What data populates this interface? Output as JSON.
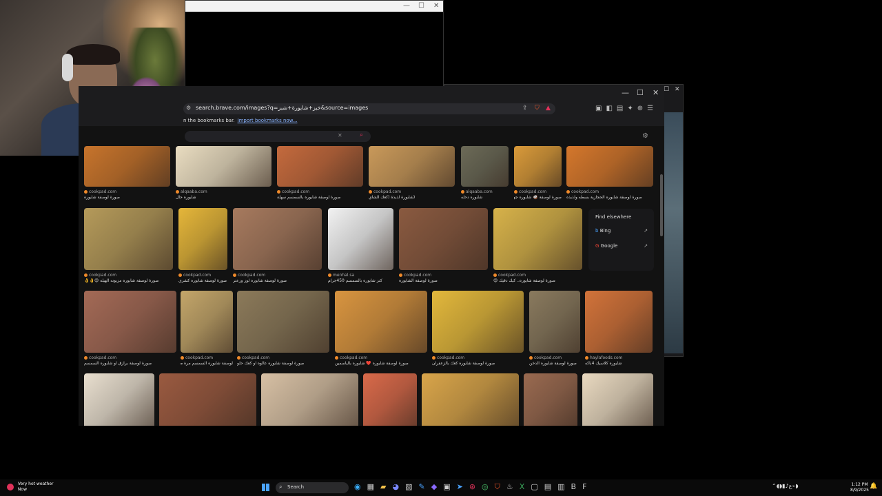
{
  "browser": {
    "url": "search.brave.com/images?q=خبز+شايورة+شبز&source=images",
    "bookmarks_prefix": "n the bookmarks bar.",
    "bookmarks_link": "Import bookmarks now..."
  },
  "find_elsewhere": {
    "heading": "Find elsewhere",
    "engines": [
      "Bing",
      "Google"
    ]
  },
  "rows": [
    [
      {
        "src": "cookpad.com",
        "cap": "صورة لوصفة شايوره",
        "color": "#c7742c"
      },
      {
        "src": "alqaaba.com",
        "cap": "شايوره حال",
        "color": "#e9dcc0"
      },
      {
        "src": "cookpad.com",
        "cap": "صورة لوصفة شايوره بالسمسم سهلة",
        "color": "#c46a3d"
      },
      {
        "src": "cookpad.com",
        "cap": "(شايورة لذيذة (كعك الشاي",
        "color": "#c9995a"
      },
      {
        "src": "alqaaba.com",
        "cap": "شايوره دحله",
        "color": "#6c6a57"
      },
      {
        "src": "cookpad.com",
        "cap": "صورة لوصفة 🥥 شايوره جوز الهند",
        "color": "#d99a3a"
      },
      {
        "src": "cookpad.com",
        "cap": "صورة لوصفة شايوره الحجازية بسطه ولذيذه",
        "color": "#d4772c"
      }
    ],
    [
      {
        "src": "cookpad.com",
        "cap": "صورة لوصفة شايوره مزيونه الهيله 😍👌👌",
        "color": "#b59a5a"
      },
      {
        "src": "cookpad.com",
        "cap": "صورة لوصفة شايوره كشري",
        "color": "#e5b63a"
      },
      {
        "src": "cookpad.com",
        "cap": "صورة لوصفة شايوره لوز وزعتر",
        "color": "#a77a5e"
      },
      {
        "src": "menhal.sa",
        "cap": "كنز شايوره بالسمسم 450جرام",
        "color": "#f2f2f2"
      },
      {
        "src": "cookpad.com",
        "cap": "صورة لوصفة الشايوره",
        "color": "#8a5a40"
      },
      {
        "src": "cookpad.com",
        "cap": "صورة لوصفة شايوره.. كيك دقيك 😍",
        "color": "#d7b24a"
      }
    ],
    [
      {
        "src": "cookpad.com",
        "cap": "صورة لوصفة برازق او شايوره السمسم",
        "color": "#a46a56"
      },
      {
        "src": "cookpad.com",
        "cap": "لوصفة شايوره السمسم مرة طرية",
        "color": "#c4a66a"
      },
      {
        "src": "cookpad.com",
        "cap": "صورة لوصفة شايوره عالوه او كعك حلو",
        "color": "#8c7a5a"
      },
      {
        "src": "cookpad.com",
        "cap": "صورة لوصفة شايوره ❤️ شايوره بالياسمين",
        "color": "#d99540"
      },
      {
        "src": "cookpad.com",
        "cap": "صورة لوصفة شايوره كعك بالزعفران",
        "color": "#e3b83c"
      },
      {
        "src": "cookpad.com",
        "cap": "صورة لوصفة شايوره الدخن",
        "color": "#8a7a5e"
      },
      {
        "src": "haylafoods.com",
        "cap": "شايوره كلاسيك 4باكه",
        "color": "#d2733a"
      }
    ],
    [
      {
        "src": "",
        "cap": "",
        "color": "#e9dfcf"
      },
      {
        "src": "",
        "cap": "",
        "color": "#9a5a40"
      },
      {
        "src": "",
        "cap": "",
        "color": "#d7c0a4"
      },
      {
        "src": "",
        "cap": "",
        "color": "#d96a4a"
      },
      {
        "src": "",
        "cap": "",
        "color": "#d9a54a"
      },
      {
        "src": "",
        "cap": "",
        "color": "#9a6a50"
      },
      {
        "src": "",
        "cap": "",
        "color": "#e9d9c0"
      }
    ]
  ],
  "taskbar": {
    "weather_title": "Very hot weather",
    "weather_sub": "Now",
    "search_label": "Search",
    "lang": "ع",
    "time": "1:12 PM",
    "date": "8/9/2025"
  }
}
